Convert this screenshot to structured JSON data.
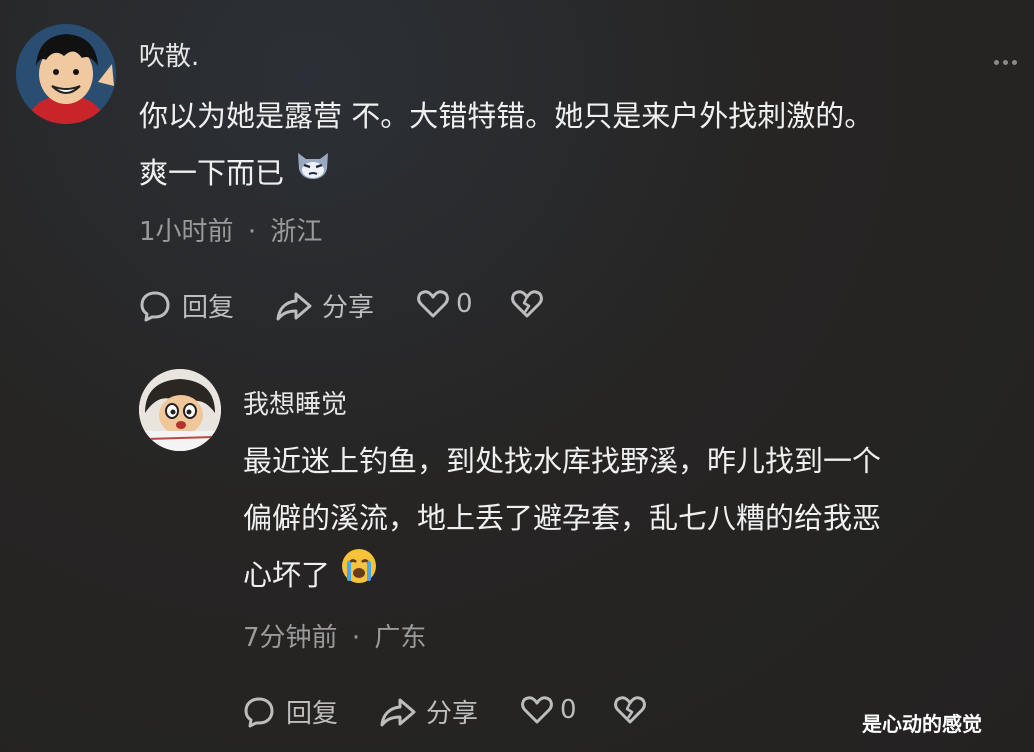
{
  "comment": {
    "username": "吹散.",
    "line1": "你以为她是露营 不。大错特错。她只是来户外找刺激的。",
    "line2": "爽一下而已",
    "emoji": "cat-face",
    "time": "1小时前",
    "region": "浙江",
    "separator": "·",
    "reply_label": "回复",
    "share_label": "分享",
    "like_count": "0"
  },
  "reply": {
    "username": "我想睡觉",
    "line1": "最近迷上钓鱼，到处找水库找野溪，昨儿找到一个",
    "line2": "偏僻的溪流，地上丢了避孕套，乱七八糟的给我恶",
    "line3": "心坏了",
    "emoji": "crying-face",
    "time": "7分钟前",
    "region": "广东",
    "separator": "·",
    "reply_label": "回复",
    "share_label": "分享",
    "like_count": "0"
  },
  "watermark": "是心动的感觉",
  "colors": {
    "background": "#252423",
    "text": "#f0f0f0",
    "meta": "#9a9a9a",
    "icon": "#bdbdbd"
  }
}
